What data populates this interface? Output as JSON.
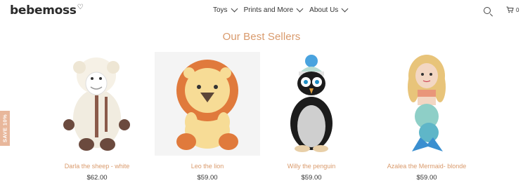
{
  "header": {
    "logo": "bebemoss",
    "nav": [
      "Toys",
      "Prints and More",
      "About Us"
    ],
    "cart_count": "0"
  },
  "section_title": "Our Best Sellers",
  "promo_tab": "SAVE 10%",
  "products": [
    {
      "name": "Darla the sheep - white",
      "price": "$62.00"
    },
    {
      "name": "Leo the lion",
      "price": "$59.00"
    },
    {
      "name": "Willy the penguin",
      "price": "$59.00"
    },
    {
      "name": "Azalea the Mermaid- blonde",
      "price": "$59.00"
    }
  ],
  "colors": {
    "accent": "#d99a6c",
    "promo": "#e8b79b",
    "text": "#333333"
  }
}
